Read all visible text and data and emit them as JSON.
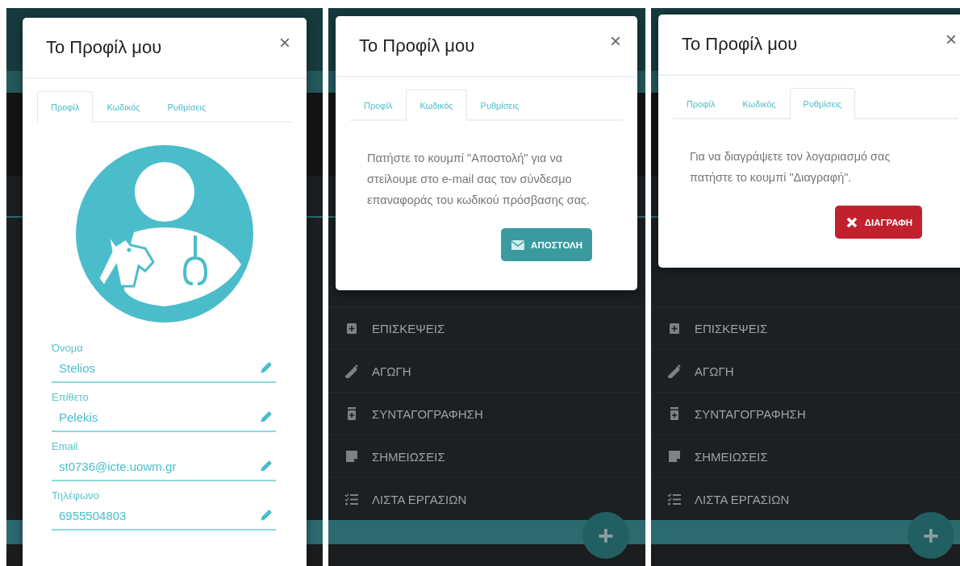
{
  "panels": [
    {
      "modal": {
        "title": "Το Προφίλ μου",
        "close": "×",
        "tabs": [
          {
            "label": "Προφίλ",
            "selected": true
          },
          {
            "label": "Κωδικός",
            "selected": false
          },
          {
            "label": "Ρυθμίσεις",
            "selected": false
          }
        ],
        "body": {
          "kind": "profile",
          "fields": [
            {
              "label": "Όνομα",
              "value": "Stelios"
            },
            {
              "label": "Επίθετο",
              "value": "Pelekis"
            },
            {
              "label": "Email",
              "value": "st0736@icte.uowm.gr"
            },
            {
              "label": "Τηλέφωνο",
              "value": "6955504803"
            }
          ]
        }
      }
    },
    {
      "modal": {
        "title": "Το Προφίλ μου",
        "close": "×",
        "tabs": [
          {
            "label": "Προφίλ",
            "selected": false
          },
          {
            "label": "Κωδικός",
            "selected": true
          },
          {
            "label": "Ρυθμίσεις",
            "selected": false
          }
        ],
        "body": {
          "kind": "message",
          "text": "Πατήστε το κουμπί \"Αποστολή\" για να στείλουμε στο e-mail σας τον σύνδεσμο επαναφοράς του κωδικού πρόσβασης σας.",
          "button": {
            "kind": "send",
            "label": "ΑΠΟΣΤΟΛΗ"
          }
        }
      },
      "menu": [
        "ΕΠΙΣΚΕΨΕΙΣ",
        "ΑΓΩΓΗ",
        "ΣΥΝΤΑΓΟΓΡΑΦΗΣΗ",
        "ΣΗΜΕΙΩΣΕΙΣ",
        "ΛΙΣΤΑ ΕΡΓΑΣΙΩΝ"
      ],
      "fab": "+"
    },
    {
      "modal": {
        "title": "Το Προφίλ μου",
        "close": "×",
        "tabs": [
          {
            "label": "Προφίλ",
            "selected": false
          },
          {
            "label": "Κωδικός",
            "selected": false
          },
          {
            "label": "Ρυθμίσεις",
            "selected": true
          }
        ],
        "body": {
          "kind": "message",
          "text": "Για να διαγράψετε τον λογαριασμό σας πατήστε το κουμπί \"Διαγραφή\".",
          "button": {
            "kind": "delete",
            "label": "ΔΙΑΓΡΑΦΗ"
          }
        }
      },
      "menu": [
        "ΕΠΙΣΚΕΨΕΙΣ",
        "ΑΓΩΓΗ",
        "ΣΥΝΤΑΓΟΓΡΑΦΗΣΗ",
        "ΣΗΜΕΙΩΣΕΙΣ",
        "ΛΙΣΤΑ ΕΡΓΑΣΙΩΝ"
      ],
      "fab": "+"
    }
  ]
}
